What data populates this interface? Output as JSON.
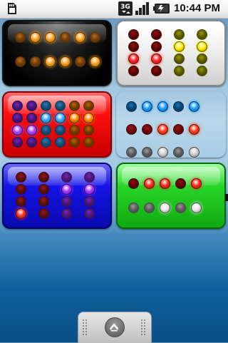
{
  "status_bar": {
    "time": "10:44 PM",
    "network_type": "3G",
    "icons": [
      "sd-card-icon",
      "network-3g-icon",
      "signal-icon",
      "battery-icon"
    ]
  },
  "widgets": [
    {
      "id": "black",
      "colors": [
        [
          "#ff8c1a",
          "#ffa020",
          "#ffa020",
          "#ff8c1a",
          "#ffa020",
          "#ff8c1a"
        ],
        [
          "#ff8c1a",
          "#ff8c1a",
          "#ffa020",
          "#ffa020",
          "#ff8c1a",
          "#ffa020"
        ]
      ],
      "lit": [
        [
          0,
          1,
          1,
          0,
          1,
          0
        ],
        [
          0,
          0,
          1,
          1,
          0,
          1
        ]
      ]
    },
    {
      "id": "white",
      "colors": [
        [
          "#cc1111",
          "#cc1111",
          "#cccc00",
          "#cccc00"
        ],
        [
          "#cc1111",
          "#cc1111",
          "#ffee00",
          "#ffee00"
        ],
        [
          "#ff2222",
          "#ff2222",
          "#cccc00",
          "#cccc00"
        ],
        [
          "#cc1111",
          "#cc1111",
          "#cccc00",
          "#cccc00"
        ]
      ],
      "lit": [
        [
          0,
          0,
          0,
          0
        ],
        [
          0,
          0,
          1,
          1
        ],
        [
          1,
          1,
          0,
          0
        ],
        [
          0,
          0,
          0,
          0
        ]
      ]
    },
    {
      "id": "red",
      "colors": [
        [
          "#9933ff",
          "#9933ff",
          "#33aaff",
          "#33aaff",
          "#ff8800",
          "#ff8800"
        ],
        [
          "#9933ff",
          "#9933ff",
          "#33aaff",
          "#33aaff",
          "#ff8800",
          "#ff8800"
        ],
        [
          "#aa44ff",
          "#aa44ff",
          "#33aaff",
          "#33aaff",
          "#ff8800",
          "#ff8800"
        ],
        [
          "#9933ff",
          "#9933ff",
          "#33aaff",
          "#33aaff",
          "#ff8800",
          "#ff8800"
        ]
      ],
      "lit": [
        [
          0,
          0,
          0,
          0,
          0,
          0
        ],
        [
          0,
          0,
          1,
          1,
          1,
          1
        ],
        [
          1,
          1,
          0,
          0,
          0,
          0
        ],
        [
          0,
          0,
          0,
          0,
          0,
          0
        ]
      ]
    },
    {
      "id": "clear",
      "colors": [
        [
          "#1a9bff",
          "#1a9bff",
          "#1a9bff",
          "#1a9bff",
          "#1a9bff"
        ],
        [
          "#e01818",
          "#e01818",
          "#ff3b1a",
          "#e01818",
          "#ff3b1a"
        ],
        [
          "#d0d0d0",
          "#d0d0d0",
          "#d0d0d0",
          "#d0d0d0",
          "#d0d0d0"
        ]
      ],
      "lit": [
        [
          0,
          1,
          1,
          0,
          1
        ],
        [
          0,
          0,
          1,
          0,
          1
        ],
        [
          0,
          0,
          1,
          0,
          1
        ]
      ]
    },
    {
      "id": "blue",
      "colors": [
        [
          "#cc2222",
          "#cc2222",
          "#aa33ff",
          "#aa33ff"
        ],
        [
          "#cc2222",
          "#cc2222",
          "#aa33ff",
          "#aa33ff"
        ],
        [
          "#cc2222",
          "#cc2222",
          "#aa33ff",
          "#aa33ff"
        ],
        [
          "#ff3322",
          "#cc2222",
          "#aa33ff",
          "#aa33ff"
        ]
      ],
      "lit": [
        [
          0,
          0,
          0,
          0
        ],
        [
          0,
          0,
          1,
          1
        ],
        [
          0,
          0,
          0,
          0
        ],
        [
          1,
          0,
          0,
          0
        ]
      ]
    },
    {
      "id": "green",
      "colors": [
        [
          "#cc1111",
          "#ff2a1a",
          "#ff2a1a",
          "#cc1111",
          "#ff2a1a"
        ],
        [
          "#d0d0d0",
          "#d0d0d0",
          "#e8e8e8",
          "#d0d0d0",
          "#e8e8e8"
        ]
      ],
      "lit": [
        [
          0,
          1,
          1,
          0,
          1
        ],
        [
          0,
          0,
          1,
          0,
          1
        ]
      ]
    }
  ],
  "launcher": {
    "icon": "chevron-up-icon"
  }
}
